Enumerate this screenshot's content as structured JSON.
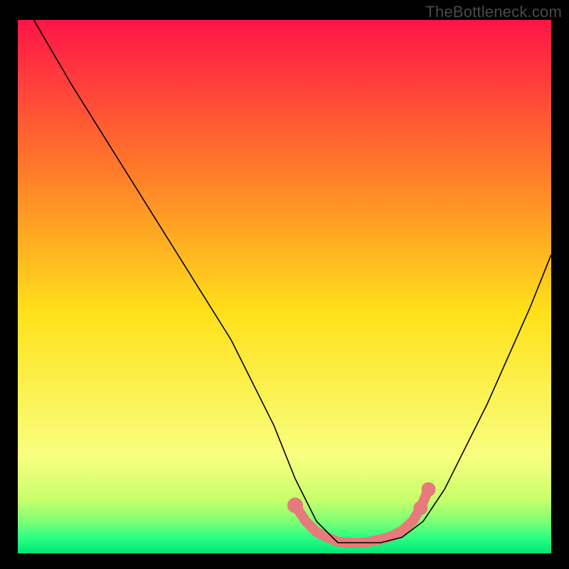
{
  "watermark": "TheBottleneck.com",
  "colors": {
    "frame": "#000000",
    "curve": "#000000",
    "accent": "#e77a7a",
    "grad_top": "#ff1447",
    "grad_mid_upper": "#ff7a2a",
    "grad_mid": "#ffe11a",
    "grad_lower": "#f8ff80",
    "grad_green1": "#c7ff6b",
    "grad_green2": "#7eff74",
    "grad_green3": "#2dff83",
    "grad_bottom": "#00e676"
  },
  "chart_data": {
    "type": "line",
    "title": "",
    "xlabel": "",
    "ylabel": "",
    "xlim": [
      0,
      100
    ],
    "ylim": [
      0,
      100
    ],
    "series": [
      {
        "name": "bottleneck-curve",
        "x": [
          3,
          10,
          20,
          30,
          40,
          48,
          52,
          56,
          60,
          64,
          68,
          72,
          76,
          80,
          88,
          96,
          100
        ],
        "y": [
          100,
          88,
          72,
          56,
          40,
          24,
          14,
          6,
          2,
          2,
          2,
          3,
          6,
          12,
          28,
          46,
          56
        ]
      }
    ],
    "accent_segment": {
      "comment": "thick salmon dots along the valley floor",
      "x": [
        52,
        54,
        56,
        58,
        60,
        62,
        64,
        66,
        68,
        70,
        72,
        74,
        75.5,
        77
      ],
      "y": [
        9,
        6,
        4,
        3,
        2.2,
        2,
        2,
        2.2,
        2.6,
        3.2,
        4.2,
        6,
        8.5,
        12
      ]
    }
  }
}
